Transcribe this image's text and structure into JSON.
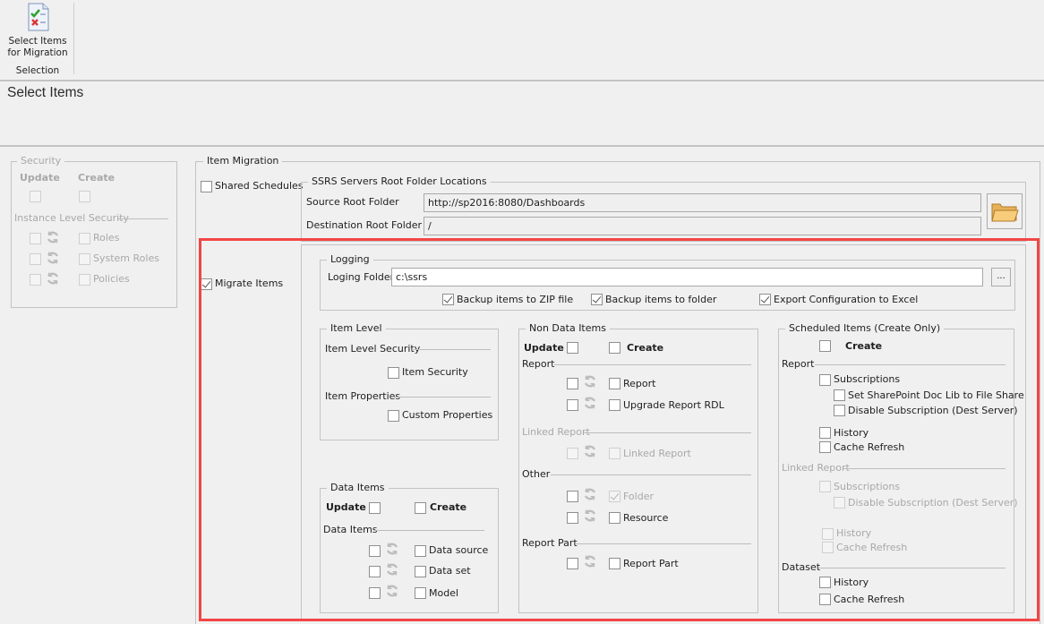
{
  "ribbon": {
    "button_label_line1": "Select Items",
    "button_label_line2": "for Migration",
    "button_icon": "checklist-icon",
    "group_label": "Selection"
  },
  "header": {
    "title": "Select Items"
  },
  "security": {
    "title": "Security",
    "update_label": "Update",
    "create_label": "Create",
    "update_checked": false,
    "create_checked": false,
    "instance_level_label": "Instance Level Security",
    "items": [
      {
        "label": "Roles",
        "checked": false
      },
      {
        "label": "System Roles",
        "checked": false
      },
      {
        "label": "Policies",
        "checked": false
      }
    ],
    "enabled": false
  },
  "item_migration": {
    "title": "Item Migration",
    "shared_schedules_label": "Shared Schedules",
    "shared_schedules_checked": false,
    "root_folders": {
      "title": "SSRS Servers Root Folder Locations",
      "source_label": "Source Root Folder",
      "source_value": "http://sp2016:8080/Dashboards",
      "destination_label": "Destination Root Folder",
      "destination_value": "/",
      "browse_icon": "folder-open-icon"
    },
    "migrate_items_label": "Migrate Items",
    "migrate_items_checked": true
  },
  "logging": {
    "title": "Logging",
    "folder_label": "Loging Folder",
    "folder_value": "c:\\ssrs",
    "browse_label": "...",
    "options": [
      {
        "label": "Backup items to ZIP file",
        "checked": true
      },
      {
        "label": "Backup items to folder",
        "checked": true
      },
      {
        "label": "Export Configuration to Excel",
        "checked": true
      }
    ]
  },
  "item_level": {
    "title": "Item Level",
    "security_section": "Item Level Security",
    "item_security_label": "Item Security",
    "properties_section": "Item Properties",
    "custom_properties_label": "Custom Properties"
  },
  "data_items": {
    "title": "Data Items",
    "update_label": "Update",
    "create_label": "Create",
    "section_label": "Data Items",
    "items": [
      {
        "label": "Data source"
      },
      {
        "label": "Data set"
      },
      {
        "label": "Model"
      }
    ]
  },
  "non_data_items": {
    "title": "Non Data Items",
    "update_label": "Update",
    "create_label": "Create",
    "report_section": "Report",
    "report_items": [
      {
        "label": "Report"
      },
      {
        "label": "Upgrade Report RDL"
      }
    ],
    "linked_report_section": "Linked Report",
    "linked_report_item": "Linked Report",
    "other_section": "Other",
    "folder_label": "Folder",
    "folder_checked": true,
    "resource_label": "Resource",
    "report_part_section": "Report Part",
    "report_part_label": "Report Part"
  },
  "scheduled_items": {
    "title": "Scheduled Items (Create Only)",
    "create_label": "Create",
    "report_section": "Report",
    "report_subscriptions": "Subscriptions",
    "report_set_sharepoint": "Set SharePoint Doc Lib to File Share",
    "report_disable_subscription": "Disable Subscription (Dest Server)",
    "report_history": "History",
    "report_cache_refresh": "Cache Refresh",
    "linked_section": "Linked Report",
    "linked_subscriptions": "Subscriptions",
    "linked_disable_subscription": "Disable Subscription (Dest Server)",
    "linked_history": "History",
    "linked_cache_refresh": "Cache Refresh",
    "dataset_section": "Dataset",
    "dataset_history": "History",
    "dataset_cache_refresh": "Cache Refresh"
  },
  "colors": {
    "highlight": "#f34545",
    "background": "#f0f0f0"
  }
}
